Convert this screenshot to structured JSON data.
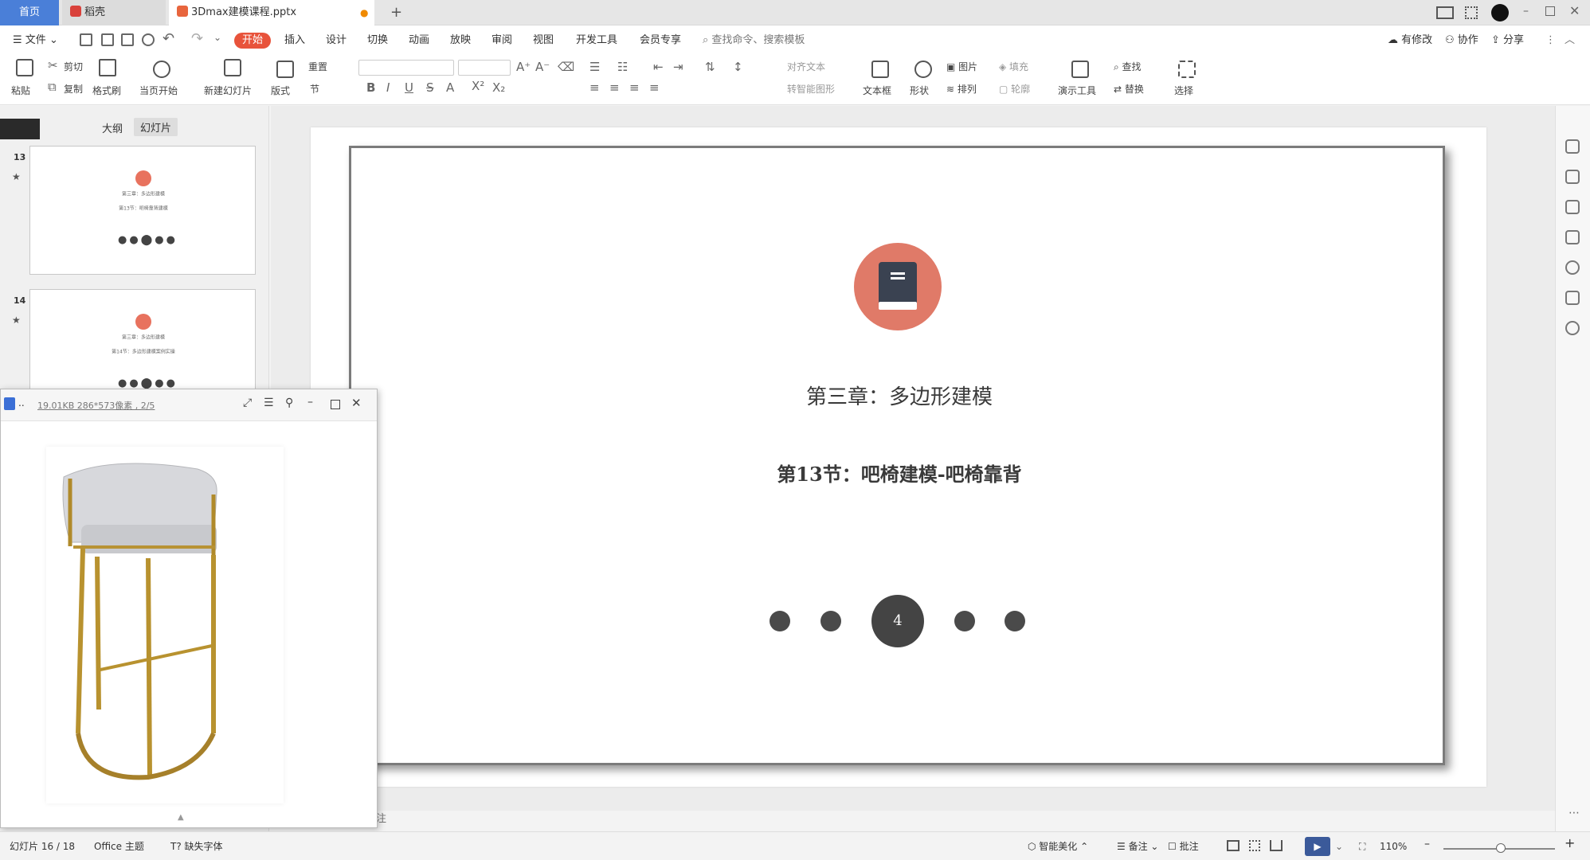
{
  "tabs": {
    "home": "首页",
    "daoke": "稻壳",
    "file": "3Dmax建模课程.pptx",
    "new_tab": "+"
  },
  "menubar": {
    "file": "文件",
    "items": [
      "开始",
      "插入",
      "设计",
      "切换",
      "动画",
      "放映",
      "审阅",
      "视图",
      "开发工具",
      "会员专享"
    ],
    "search": "查找命令、搜索模板",
    "right": [
      "有修改",
      "协作",
      "分享"
    ]
  },
  "ribbon": {
    "paste": "粘贴",
    "cut": "剪切",
    "copy": "复制",
    "format_painter": "格式刷",
    "from_current": "当页开始",
    "new_slide": "新建幻灯片",
    "layout": "版式",
    "reset": "重置",
    "section": "节",
    "align_text": "对齐文本",
    "smart_graphic": "转智能图形",
    "textbox": "文本框",
    "shapes": "形状",
    "picture": "图片",
    "arrange": "排列",
    "fill": "填充",
    "outline": "轮廓",
    "present_tools": "演示工具",
    "find": "查找",
    "replace": "替换",
    "select": "选择"
  },
  "leftpanel": {
    "tab_outline": "大纲",
    "tab_slides": "幻灯片",
    "thumbs": [
      {
        "num": "13",
        "line1": "第三章：多边形建模",
        "line2": "第13节：吧椅靠背建模"
      },
      {
        "num": "14",
        "line1": "第三章：多边形建模",
        "line2": "第14节：多边形建模案例实操"
      }
    ]
  },
  "slide": {
    "chapter": "第三章：多边形建模",
    "section": "第13节：吧椅建模-吧椅靠背",
    "page_dot": "4"
  },
  "viewer": {
    "title": "..",
    "info": "19.01KB  286*573像素 , 2/5"
  },
  "status": {
    "slide": "幻灯片 16 / 18",
    "theme": "Office 主题",
    "missing_font": "缺失字体",
    "beautify": "智能美化",
    "notes": "备注",
    "comments": "批注",
    "zoom": "110%",
    "notes_hint": "注"
  }
}
